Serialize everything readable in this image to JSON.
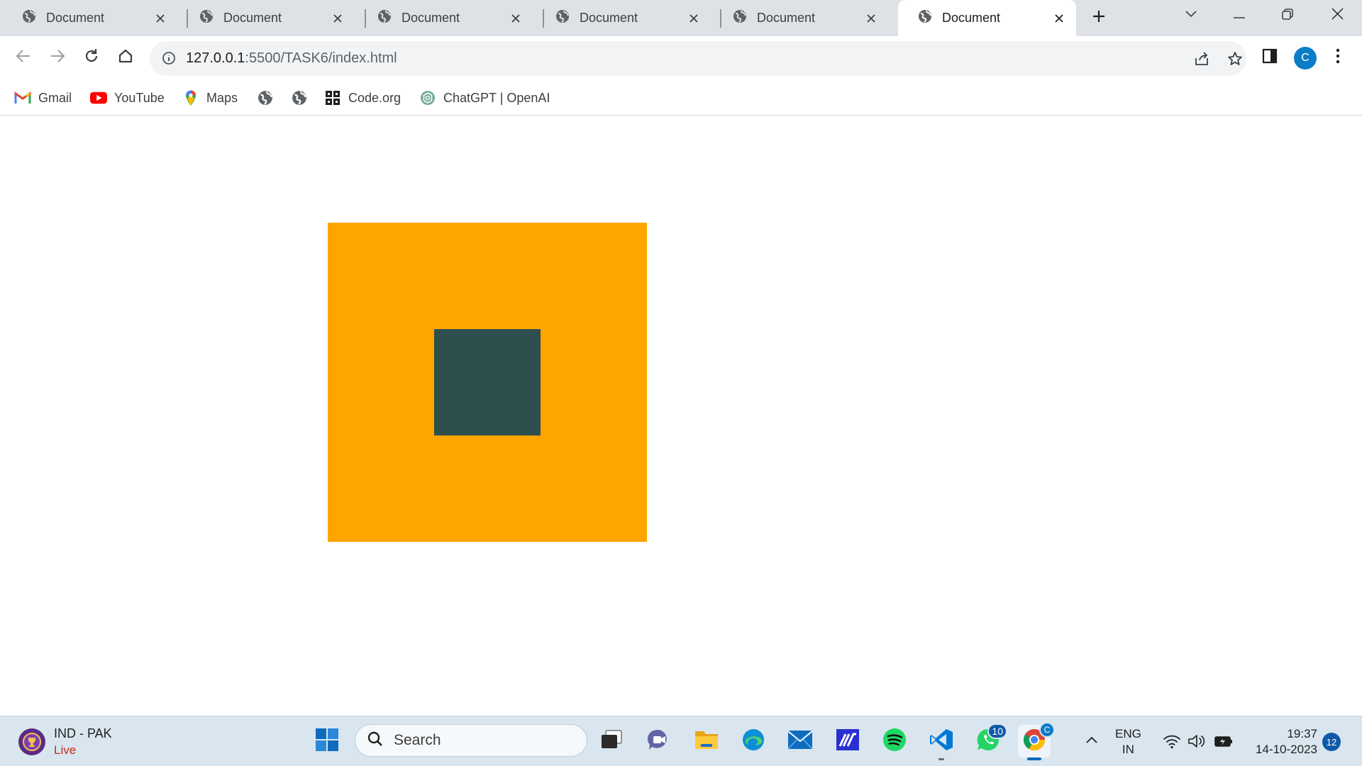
{
  "browser": {
    "tabs": [
      {
        "title": "Document",
        "active": false
      },
      {
        "title": "Document",
        "active": false
      },
      {
        "title": "Document",
        "active": false
      },
      {
        "title": "Document",
        "active": false
      },
      {
        "title": "Document",
        "active": false
      },
      {
        "title": "Document",
        "active": true
      }
    ],
    "icons": {
      "tab": "globe-icon",
      "close": "close-icon",
      "new_tab": "plus-icon",
      "tab_search": "chevron-down-icon",
      "minimize": "minimize-icon",
      "restore": "restore-icon",
      "window_close": "close-icon"
    }
  },
  "toolbar": {
    "url_host": "127.0.0.1",
    "url_path": ":5500/TASK6/index.html",
    "profile_initial": "C",
    "icons": [
      "back-icon",
      "forward-icon",
      "reload-icon",
      "home-icon",
      "info-icon",
      "share-icon",
      "star-icon",
      "side-panel-icon",
      "kebab-menu-icon"
    ]
  },
  "bookmarks": [
    {
      "label": "Gmail",
      "icon": "gmail-icon"
    },
    {
      "label": "YouTube",
      "icon": "youtube-icon"
    },
    {
      "label": "Maps",
      "icon": "maps-icon"
    },
    {
      "label": "",
      "icon": "globe-icon"
    },
    {
      "label": "",
      "icon": "globe-icon"
    },
    {
      "label": "Code.org",
      "icon": "code-org-icon"
    },
    {
      "label": "ChatGPT | OpenAI",
      "icon": "chatgpt-icon"
    }
  ],
  "page": {
    "outer_color": "#ffa500",
    "inner_color": "#2f4f4f"
  },
  "taskbar": {
    "widget": {
      "title": "IND - PAK",
      "subtitle": "Live"
    },
    "search_placeholder": "Search",
    "apps": [
      "windows-start-icon",
      "task-view-icon",
      "teams-chat-icon",
      "file-explorer-icon",
      "edge-icon",
      "mail-icon",
      "app-icon",
      "spotify-icon",
      "vscode-icon",
      "whatsapp-icon",
      "chrome-icon"
    ],
    "whatsapp_badge": "10",
    "chrome_badge": "C",
    "language": {
      "line1": "ENG",
      "line2": "IN"
    },
    "clock": {
      "time": "19:37",
      "date": "14-10-2023"
    },
    "notifications": "12"
  }
}
